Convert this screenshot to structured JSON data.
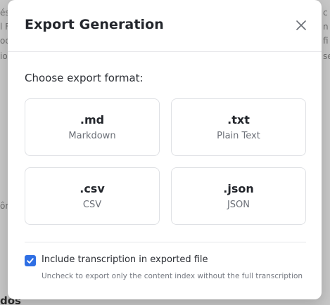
{
  "background": {
    "fragments_left": [
      "és",
      "l F",
      "od",
      "io"
    ],
    "fragments_right": [
      "c",
      "n",
      "fi",
      "se"
    ],
    "fragment_mid_left": "ôn",
    "fragment_bottom": "dos"
  },
  "modal": {
    "title": "Export Generation",
    "close_icon": "close-icon",
    "prompt": "Choose export format:",
    "formats": [
      {
        "ext": ".md",
        "name": "Markdown"
      },
      {
        "ext": ".txt",
        "name": "Plain Text"
      },
      {
        "ext": ".csv",
        "name": "CSV"
      },
      {
        "ext": ".json",
        "name": "JSON"
      }
    ],
    "include_transcription": {
      "checked": true,
      "label": "Include transcription in exported file",
      "hint": "Uncheck to export only the content index without the full transcription"
    }
  },
  "colors": {
    "accent": "#2f6fe4",
    "overlay": "#c7c7c7",
    "title_text": "#23262c"
  }
}
